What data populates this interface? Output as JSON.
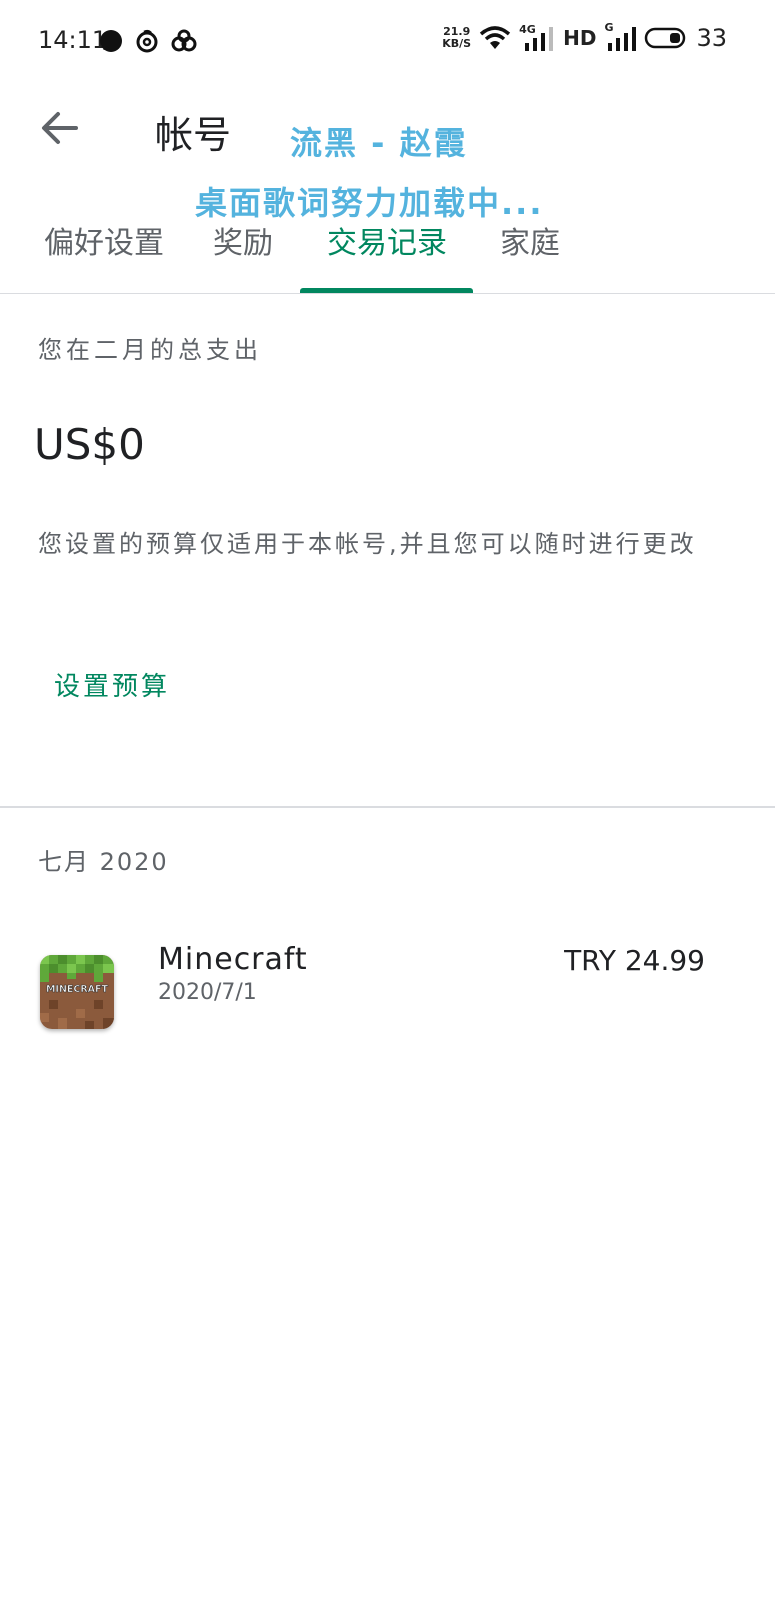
{
  "status_bar": {
    "time": "14:11",
    "net_speed_value": "21.9",
    "net_speed_unit": "KB/S",
    "net_type": "4G",
    "hd": "HD",
    "sim2": "G",
    "battery": "33",
    "icons": [
      "chat-bubble-icon",
      "netease-music-icon",
      "app-icon",
      "wifi-icon",
      "signal-icon",
      "battery-icon"
    ]
  },
  "header": {
    "title": "帐号",
    "back_icon": "arrow-back-icon"
  },
  "lyrics_overlay": {
    "line1": "流黑 - 赵霞",
    "line2": "桌面歌词努力加载中..."
  },
  "tabs": [
    {
      "label": "偏好设置",
      "active": false
    },
    {
      "label": "奖励",
      "active": false
    },
    {
      "label": "交易记录",
      "active": true
    },
    {
      "label": "家庭",
      "active": false
    }
  ],
  "spending": {
    "label": "您在二月的总支出",
    "amount": "US$0",
    "budget_description": "您设置的预算仅适用于本帐号,并且您可以随时进行更改",
    "set_budget_label": "设置预算"
  },
  "history": {
    "month_label": "七月 2020",
    "items": [
      {
        "name": "Minecraft",
        "date": "2020/7/1",
        "price": "TRY 24.99",
        "icon_text": "MINECRAFT"
      }
    ]
  },
  "colors": {
    "accent": "#01875f",
    "lyrics": "#54b3de",
    "divider": "#dadce0"
  }
}
